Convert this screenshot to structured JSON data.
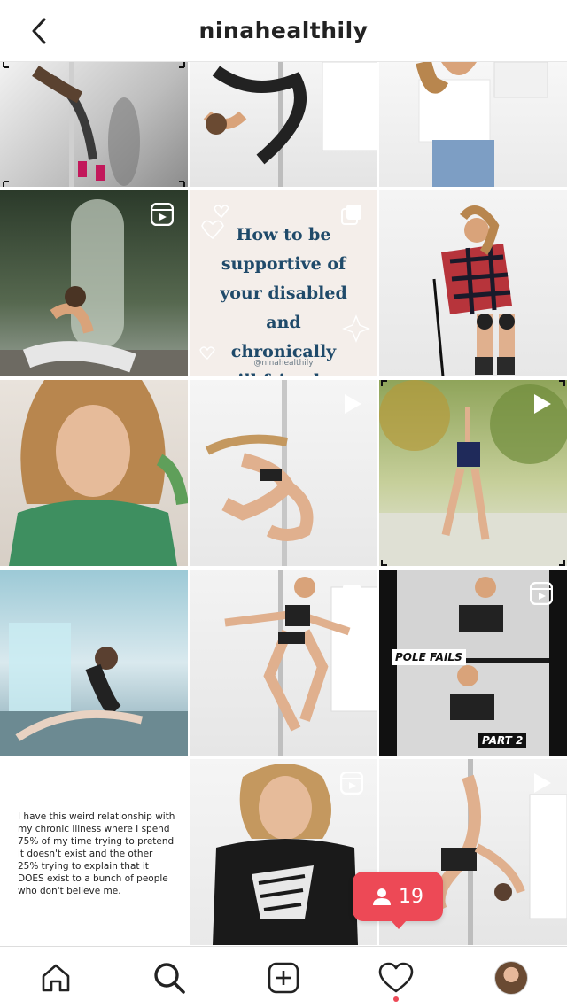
{
  "header": {
    "title": "ninahealthily"
  },
  "grid": {
    "quote_tile": {
      "text": "How to be\nsupportive of\nyour disabled and\nchronically\nill friends",
      "handle": "@ninahealthily"
    },
    "text_post": "I have this weird relationship with my chronic illness where I spend 75% of my time trying to pretend it doesn't exist and the other 25% trying to explain that it DOES exist to a bunch of people who don't believe me.",
    "reel_labels": {
      "title": "POLE FAILS",
      "part": "PART 2"
    }
  },
  "notification": {
    "count": "19"
  },
  "colors": {
    "accent": "#ed4956",
    "quote_text": "#1f4a6a"
  }
}
